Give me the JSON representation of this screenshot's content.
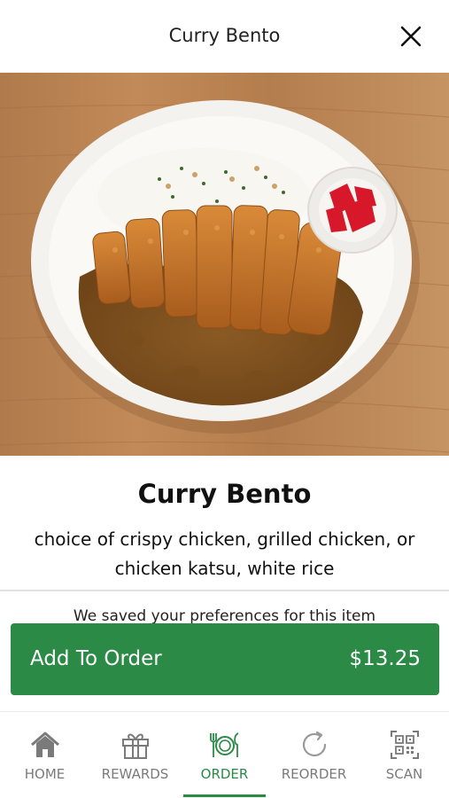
{
  "header": {
    "title": "Curry Bento",
    "close_icon": "close-icon"
  },
  "item": {
    "image_alt": "Curry bento with chicken katsu, curry sauce, white rice and pickled ginger",
    "name": "Curry Bento",
    "description": "choice of crispy chicken, grilled chicken, or chicken katsu, white rice"
  },
  "preferences_note": "We saved your preferences for this item",
  "add_button": {
    "label": "Add To Order",
    "price": "$13.25",
    "color": "#2a8a46"
  },
  "tabbar": {
    "active_color": "#2a8a46",
    "inactive_color": "#7a7a7a",
    "tabs": [
      {
        "label": "HOME",
        "icon": "home-icon",
        "active": false
      },
      {
        "label": "REWARDS",
        "icon": "gift-icon",
        "active": false
      },
      {
        "label": "ORDER",
        "icon": "plate-cutlery-icon",
        "active": true
      },
      {
        "label": "REORDER",
        "icon": "reload-icon",
        "active": false
      },
      {
        "label": "SCAN",
        "icon": "qr-code-icon",
        "active": false
      }
    ]
  }
}
